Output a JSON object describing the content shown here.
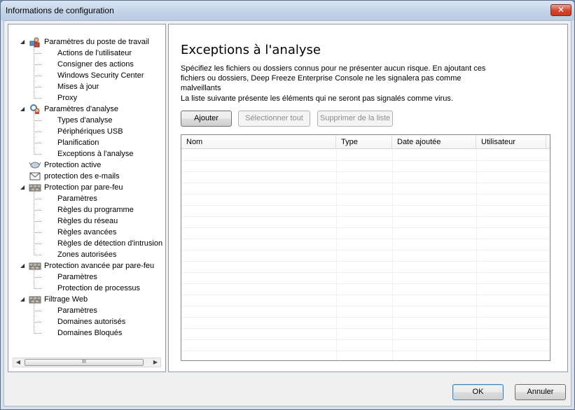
{
  "window": {
    "title": "Informations de configuration",
    "close_label": "✕"
  },
  "tree": {
    "items": [
      {
        "label": "Paramètres du poste de travail",
        "level": 0,
        "icon": "workstation-settings-icon",
        "expanded": true
      },
      {
        "label": "Actions de l'utilisateur",
        "level": 1
      },
      {
        "label": "Consigner des actions",
        "level": 1
      },
      {
        "label": "Windows Security Center",
        "level": 1
      },
      {
        "label": "Mises à jour",
        "level": 1
      },
      {
        "label": "Proxy",
        "level": 1
      },
      {
        "label": "Paramètres d'analyse",
        "level": 0,
        "icon": "scan-settings-icon",
        "expanded": true
      },
      {
        "label": "Types d'analyse",
        "level": 1
      },
      {
        "label": "Périphériques USB",
        "level": 1
      },
      {
        "label": "Planification",
        "level": 1
      },
      {
        "label": "Exceptions à l'analyse",
        "level": 1
      },
      {
        "label": "Protection active",
        "level": 0,
        "icon": "active-protection-icon"
      },
      {
        "label": "protection des e-mails",
        "level": 0,
        "icon": "email-icon"
      },
      {
        "label": "Protection par pare-feu",
        "level": 0,
        "icon": "firewall-icon",
        "expanded": true
      },
      {
        "label": "Paramètres",
        "level": 1
      },
      {
        "label": "Règles du programme",
        "level": 1
      },
      {
        "label": "Règles du réseau",
        "level": 1
      },
      {
        "label": "Règles avancées",
        "level": 1
      },
      {
        "label": "Règles de détection d'intrusion",
        "level": 1
      },
      {
        "label": "Zones autorisées",
        "level": 1
      },
      {
        "label": "Protection avancée par pare-feu",
        "level": 0,
        "icon": "firewall-icon",
        "expanded": true
      },
      {
        "label": "Paramètres",
        "level": 1
      },
      {
        "label": "Protection de processus",
        "level": 1
      },
      {
        "label": "Filtrage Web",
        "level": 0,
        "icon": "firewall-icon",
        "expanded": true
      },
      {
        "label": "Paramètres",
        "level": 1
      },
      {
        "label": "Domaines autorisés",
        "level": 1
      },
      {
        "label": "Domaines Bloqués",
        "level": 1
      }
    ],
    "scroll_grip": "III"
  },
  "content": {
    "title": "Exceptions à l'analyse",
    "description": "Spécifiez les fichiers ou dossiers connus pour ne présenter aucun risque. En ajoutant ces fichiers ou dossiers, Deep Freeze Enterprise Console ne les signalera pas comme malveillants",
    "list_note": "La liste suivante présente les éléments qui ne seront pas signalés comme virus.",
    "buttons": {
      "add": "Ajouter",
      "select_all": "Sélectionner tout",
      "remove": "Supprimer de la liste"
    },
    "table": {
      "columns": [
        "Nom",
        "Type",
        "Date ajoutée",
        "Utilisateur"
      ],
      "rows": []
    }
  },
  "footer": {
    "ok": "OK",
    "cancel": "Annuler"
  }
}
